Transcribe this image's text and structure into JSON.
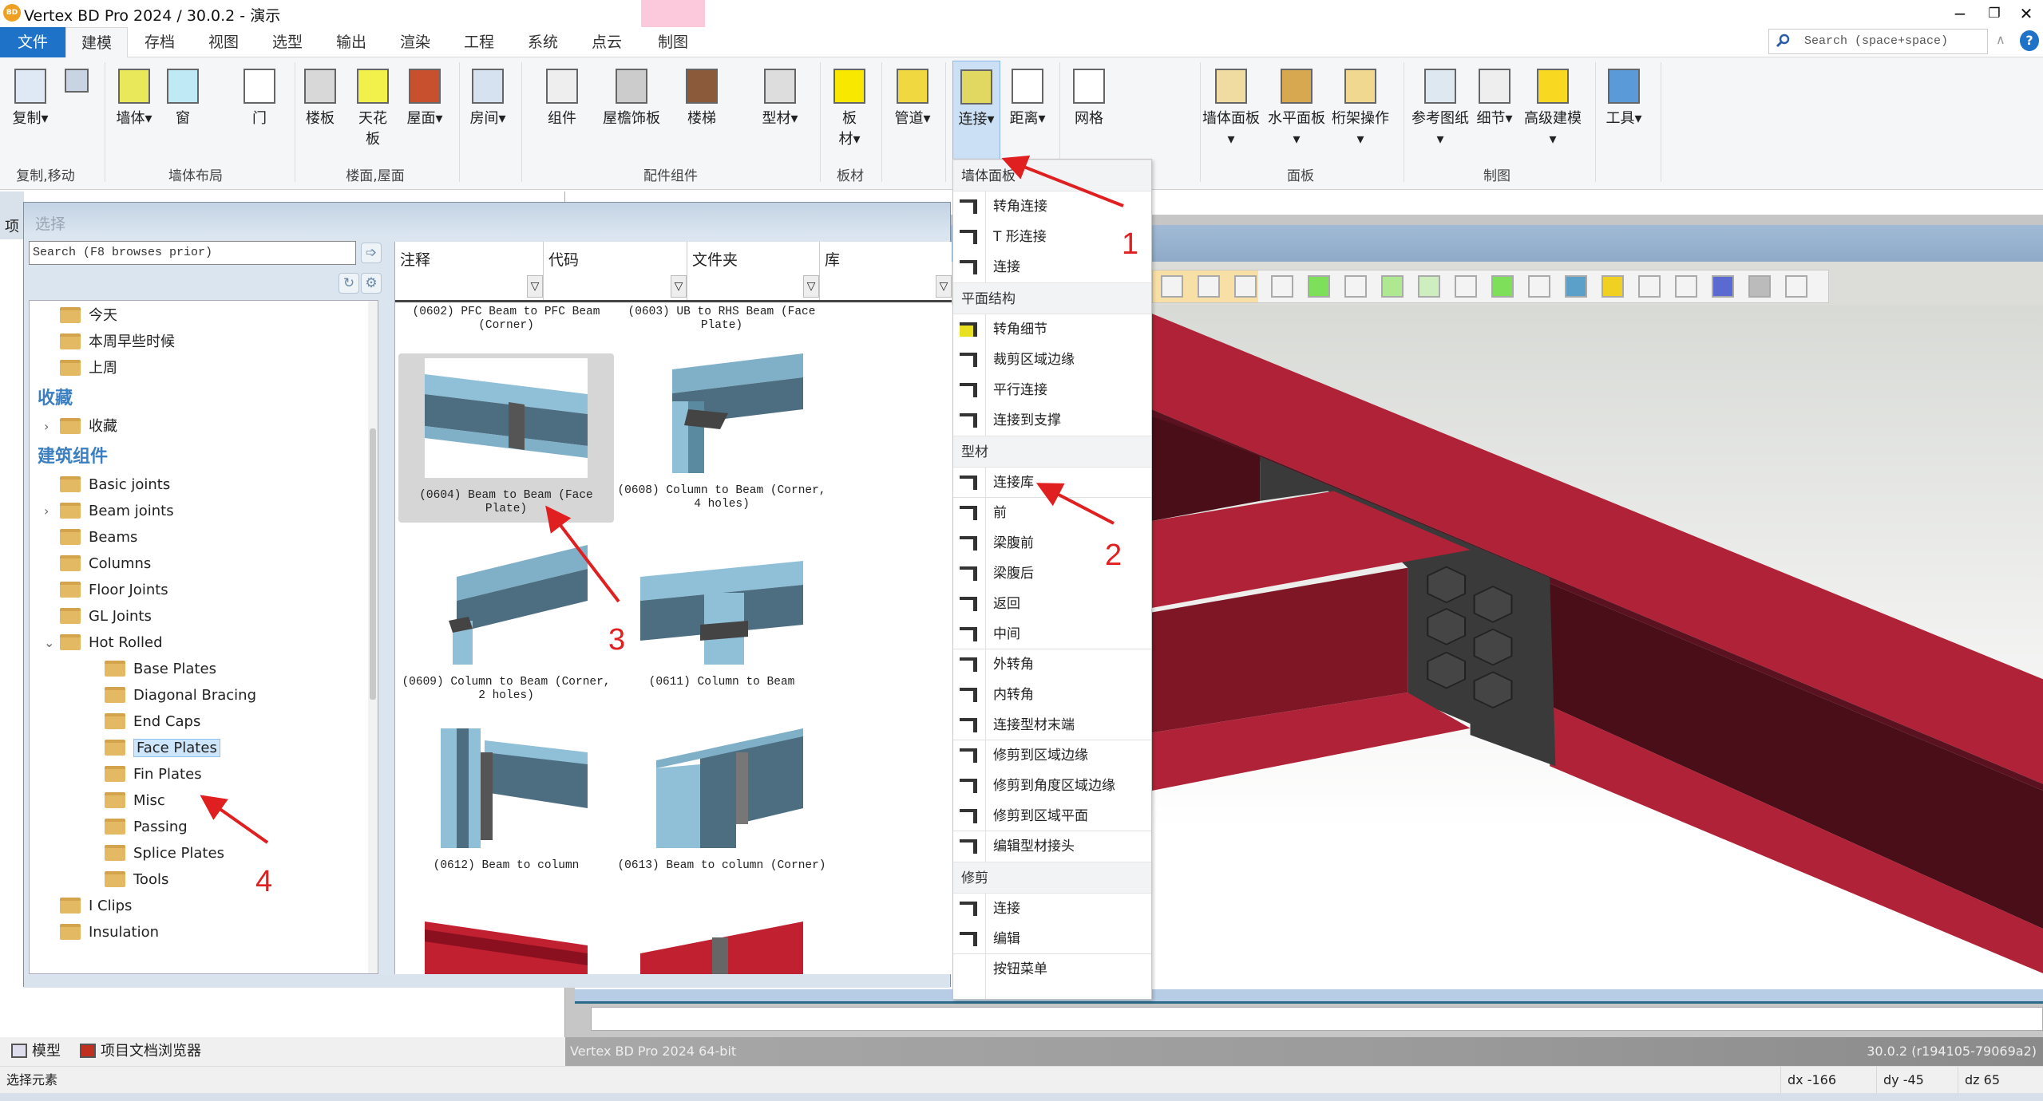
{
  "window": {
    "title": "Vertex BD Pro 2024 / 30.0.2 - 演示",
    "logo_text": "BD",
    "minimize": "−",
    "restore": "❐",
    "close": "✕"
  },
  "tabs": [
    {
      "label": "文件"
    },
    {
      "label": "建模"
    },
    {
      "label": "存档"
    },
    {
      "label": "视图"
    },
    {
      "label": "选型"
    },
    {
      "label": "输出"
    },
    {
      "label": "渲染"
    },
    {
      "label": "工程"
    },
    {
      "label": "系统"
    },
    {
      "label": "点云"
    },
    {
      "label": "制图"
    }
  ],
  "active_tab": "建模",
  "search": {
    "placeholder": "Search (space+space)",
    "collapse": "∧",
    "help": "?"
  },
  "ribbon": {
    "buttons": [
      {
        "label": "复制▾",
        "icon": "copy-icon"
      },
      {
        "label": "",
        "icon": "move-icon"
      },
      {
        "label": "墙体▾",
        "icon": "wall-icon"
      },
      {
        "label": "窗",
        "icon": "window-icon"
      },
      {
        "label": "门",
        "icon": "door-icon"
      },
      {
        "label": "楼板",
        "icon": "floor-slab-icon"
      },
      {
        "label": "天花\n板",
        "icon": "ceiling-icon"
      },
      {
        "label": "屋面▾",
        "icon": "roof-icon"
      },
      {
        "label": "房间▾",
        "icon": "room-icon"
      },
      {
        "label": "组件",
        "icon": "component-icon"
      },
      {
        "label": "屋檐饰板",
        "icon": "eave-trim-icon"
      },
      {
        "label": "楼梯",
        "icon": "stairs-icon"
      },
      {
        "label": "型材▾",
        "icon": "profile-icon"
      },
      {
        "label": "板\n材▾",
        "icon": "sheet-icon"
      },
      {
        "label": "管道▾",
        "icon": "pipe-icon"
      },
      {
        "label": "连接▾",
        "icon": "connection-icon"
      },
      {
        "label": "距离▾",
        "icon": "distance-icon"
      },
      {
        "label": "网格",
        "icon": "grid-icon"
      },
      {
        "label": "墙体面板\n▾",
        "icon": "wall-panel-icon"
      },
      {
        "label": "水平面板\n▾",
        "icon": "horizontal-panel-icon"
      },
      {
        "label": "桁架操作\n▾",
        "icon": "truss-icon"
      },
      {
        "label": "参考图纸\n▾",
        "icon": "reference-drawing-icon"
      },
      {
        "label": "细节▾",
        "icon": "detail-icon"
      },
      {
        "label": "高级建模\n▾",
        "icon": "advanced-modeling-icon"
      },
      {
        "label": "工具▾",
        "icon": "tools-icon"
      }
    ],
    "groups": [
      {
        "label": "复制,移动"
      },
      {
        "label": "墙体布局"
      },
      {
        "label": "楼面,屋面"
      },
      {
        "label": "配件组件"
      },
      {
        "label": "板材"
      },
      {
        "label": "面板"
      },
      {
        "label": "制图"
      }
    ]
  },
  "dialog": {
    "title": "选择",
    "search_placeholder": "Search (F8 browses prior)",
    "go": "➩",
    "refresh": "↻",
    "settings": "⚙",
    "tree": [
      {
        "label": "今天",
        "level": 1
      },
      {
        "label": "本周早些时候",
        "level": 1
      },
      {
        "label": "上周",
        "level": 1
      },
      {
        "label": "收藏",
        "header": true
      },
      {
        "label": "收藏",
        "level": 1,
        "expandable": true
      },
      {
        "label": "建筑组件",
        "header": true
      },
      {
        "label": "Basic joints",
        "level": 1
      },
      {
        "label": "Beam joints",
        "level": 1,
        "expandable": true
      },
      {
        "label": "Beams",
        "level": 1
      },
      {
        "label": "Columns",
        "level": 1
      },
      {
        "label": "Floor Joints",
        "level": 1
      },
      {
        "label": "GL Joints",
        "level": 1
      },
      {
        "label": "Hot Rolled",
        "level": 1,
        "expanded": true
      },
      {
        "label": "Base Plates",
        "level": 2
      },
      {
        "label": "Diagonal Bracing",
        "level": 2
      },
      {
        "label": "End Caps",
        "level": 2
      },
      {
        "label": "Face Plates",
        "level": 2,
        "selected": true
      },
      {
        "label": "Fin Plates",
        "level": 2
      },
      {
        "label": "Misc",
        "level": 2
      },
      {
        "label": "Passing",
        "level": 2
      },
      {
        "label": "Splice Plates",
        "level": 2
      },
      {
        "label": "Tools",
        "level": 2
      },
      {
        "label": "I Clips",
        "level": 1
      },
      {
        "label": "Insulation",
        "level": 1
      }
    ],
    "columns": [
      {
        "label": "注释"
      },
      {
        "label": "代码"
      },
      {
        "label": "文件夹"
      },
      {
        "label": "库"
      }
    ],
    "filter_icon": "▽",
    "items": [
      {
        "caption": "(0602) PFC Beam to PFC Beam (Corner)",
        "thumb": "none"
      },
      {
        "caption": "(0603) UB to RHS Beam (Face Plate)",
        "thumb": "none"
      },
      {
        "caption": "(0604) Beam to Beam (Face Plate)",
        "thumb": "beam-beam",
        "selected": true
      },
      {
        "caption": "(0608) Column to Beam (Corner, 4 holes)",
        "thumb": "column-beam"
      },
      {
        "caption": "(0609) Column to Beam (Corner, 2 holes)",
        "thumb": "column-beam-2"
      },
      {
        "caption": "(0611) Column to Beam",
        "thumb": "column-beam-mid"
      },
      {
        "caption": "(0612) Beam to column",
        "thumb": "beam-column"
      },
      {
        "caption": "(0613) Beam to column (Corner)",
        "thumb": "beam-column-corner"
      },
      {
        "caption": "",
        "thumb": "red-partial"
      },
      {
        "caption": "",
        "thumb": "red-partial-2"
      }
    ]
  },
  "menu": {
    "sections": [
      {
        "header": "墙体面板",
        "items": [
          {
            "label": "转角连接",
            "icon": "corner-joint-icon"
          },
          {
            "label": "T 形连接",
            "icon": "t-joint-icon"
          },
          {
            "label": "连接",
            "icon": "connect-icon"
          }
        ]
      },
      {
        "header": "平面结构",
        "items": [
          {
            "label": "转角细节",
            "icon": "corner-detail-icon"
          },
          {
            "label": "裁剪区域边缘",
            "icon": "trim-edge-icon"
          },
          {
            "label": "平行连接",
            "icon": "parallel-joint-icon"
          },
          {
            "label": "连接到支撑",
            "icon": "connect-support-icon"
          }
        ]
      },
      {
        "header": "型材",
        "items": [
          {
            "label": "连接库",
            "icon": "connection-library-icon",
            "sep": true
          },
          {
            "label": "前",
            "icon": "front-icon"
          },
          {
            "label": "梁腹前",
            "icon": "web-front-icon"
          },
          {
            "label": "梁腹后",
            "icon": "web-back-icon"
          },
          {
            "label": "返回",
            "icon": "return-icon"
          },
          {
            "label": "中间",
            "icon": "middle-icon",
            "sep": true
          },
          {
            "label": "外转角",
            "icon": "outer-corner-icon"
          },
          {
            "label": "内转角",
            "icon": "inner-corner-icon"
          },
          {
            "label": "连接型材末端",
            "icon": "connect-profile-end-icon",
            "sep": true
          },
          {
            "label": "修剪到区域边缘",
            "icon": "trim-region-edge-icon"
          },
          {
            "label": "修剪到角度区域边缘",
            "icon": "trim-angle-edge-icon"
          },
          {
            "label": "修剪到区域平面",
            "icon": "trim-region-plane-icon",
            "sep": true
          },
          {
            "label": "编辑型材接头",
            "icon": "edit-profile-joint-icon"
          }
        ]
      },
      {
        "header": "修剪",
        "items": [
          {
            "label": "连接",
            "icon": "trim-connect-icon"
          },
          {
            "label": "编辑",
            "icon": "trim-edit-icon",
            "sep": true
          },
          {
            "label": "按钮菜单",
            "icon": ""
          }
        ]
      }
    ]
  },
  "viewport": {
    "toolbar": [
      "select-point-icon",
      "select-line-icon",
      "select-face-icon",
      "filter-icon",
      "box-green-icon",
      "box-top-icon",
      "box-left-icon",
      "box-right-icon",
      "box-iso-icon",
      "box-select-icon",
      "list-icon",
      "profile-shape-icon",
      "yellow-box-icon",
      "delete-box-icon",
      "axes-icon",
      "planes-icon",
      "plus-icon",
      "export-icon"
    ],
    "status_left": "Vertex BD Pro 2024 64-bit",
    "status_right": "30.0.2 (r194105-79069a2)",
    "colors": {
      "steel": "#b02238",
      "web": "#4a0e18",
      "plate": "#3a3a3a"
    }
  },
  "bottom_tabs": [
    {
      "label": "模型",
      "icon": "model-icon"
    },
    {
      "label": "项目文档浏览器",
      "icon": "project-browser-icon"
    }
  ],
  "project_panel": {
    "label": "项"
  },
  "statusbar": {
    "message": "选择元素",
    "dx": "dx -166",
    "dy": "dy -45",
    "dz": "dz 65"
  },
  "annotations": [
    {
      "label": "1"
    },
    {
      "label": "2"
    },
    {
      "label": "3"
    },
    {
      "label": "4"
    }
  ],
  "colors": {
    "accent": "#1e73c8",
    "annotation": "#e02020",
    "tree_header": "#3c7fc1"
  }
}
